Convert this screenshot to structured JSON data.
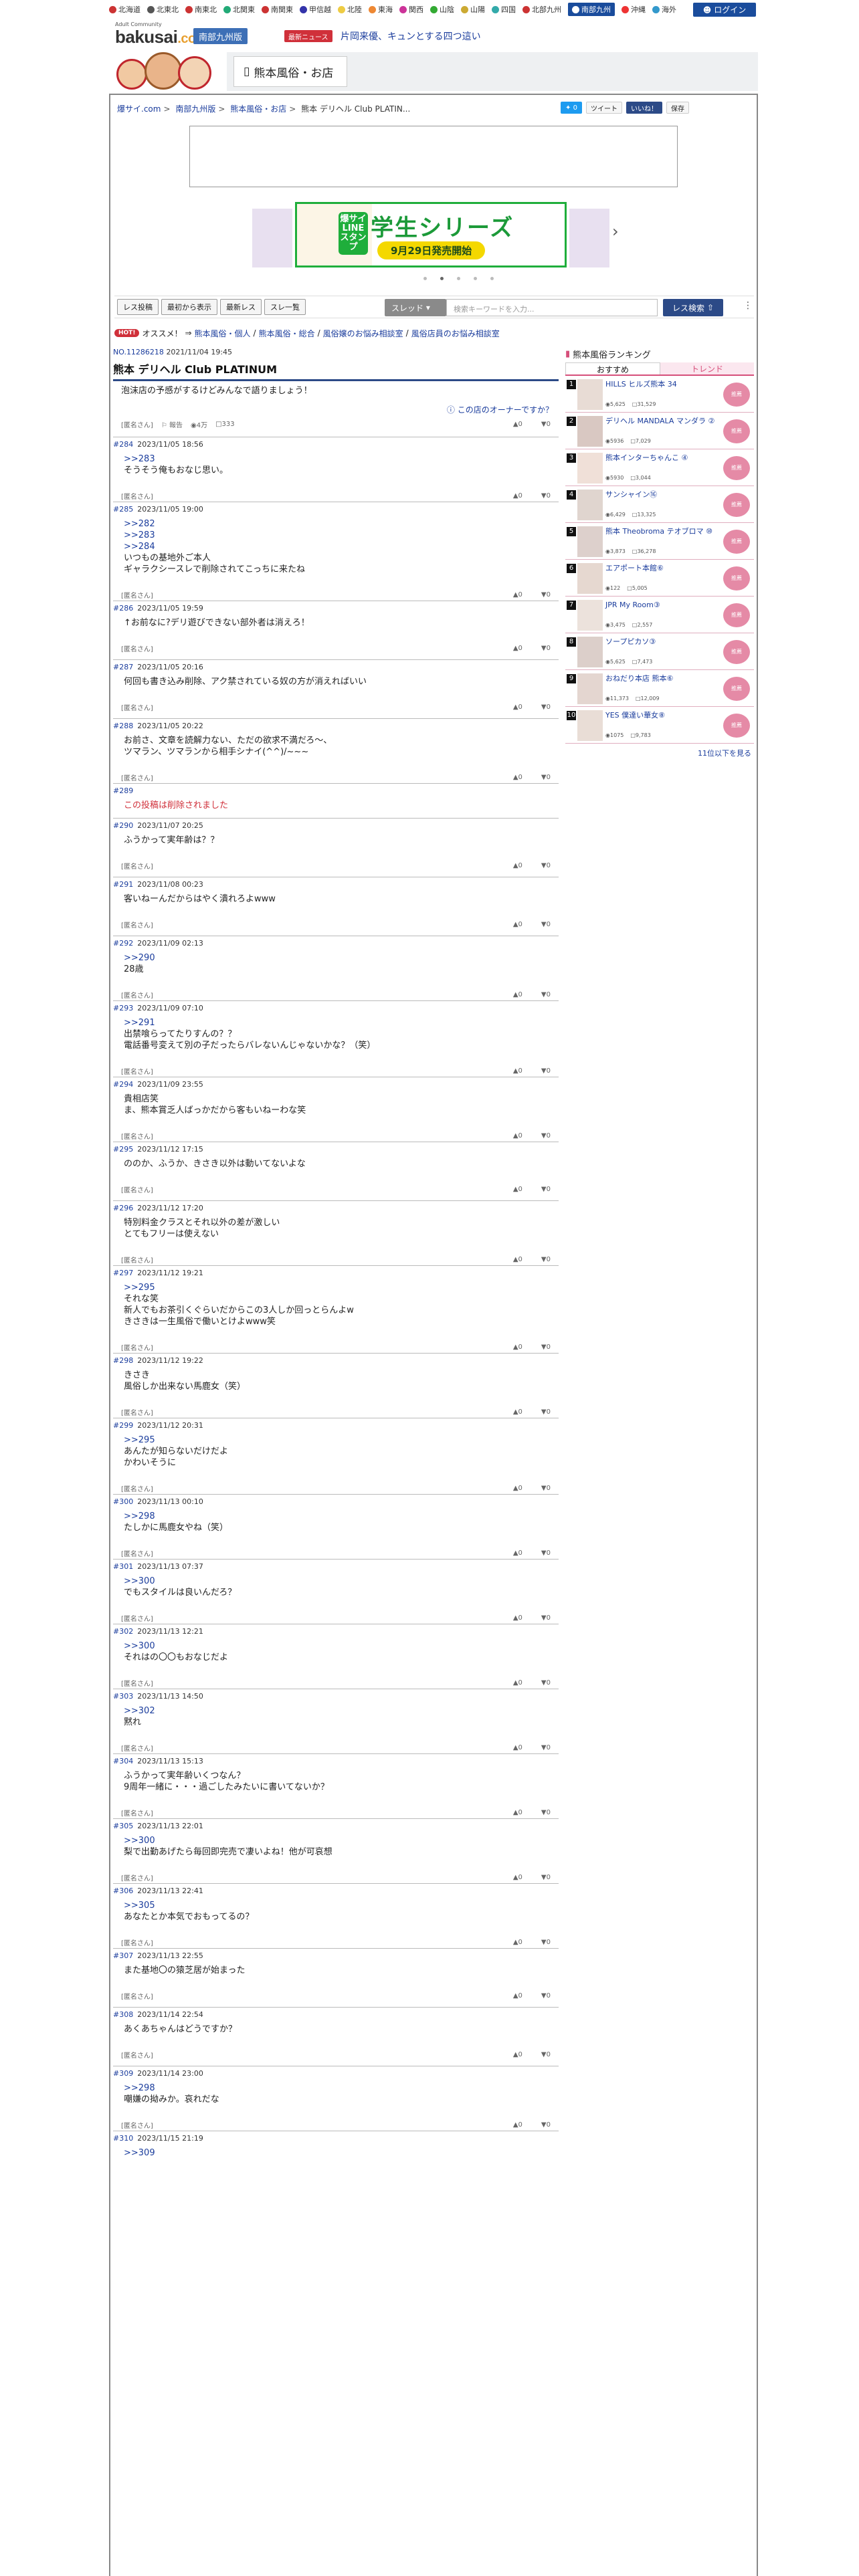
{
  "regions": [
    {
      "label": "北海道",
      "color": "#c33"
    },
    {
      "label": "北東北",
      "color": "#555"
    },
    {
      "label": "南東北",
      "color": "#c33"
    },
    {
      "label": "北関東",
      "color": "#2a7"
    },
    {
      "label": "南関東",
      "color": "#c33"
    },
    {
      "label": "甲信越",
      "color": "#33a"
    },
    {
      "label": "北陸",
      "color": "#ec4"
    },
    {
      "label": "東海",
      "color": "#e83"
    },
    {
      "label": "関西",
      "color": "#c39"
    },
    {
      "label": "山陰",
      "color": "#3a3"
    },
    {
      "label": "山陽",
      "color": "#ca3"
    },
    {
      "label": "四国",
      "color": "#3aa"
    },
    {
      "label": "北部九州",
      "color": "#c33"
    },
    {
      "label": "南部九州",
      "color": "#1a4c9c"
    },
    {
      "label": "沖縄",
      "color": "#e33"
    },
    {
      "label": "海外",
      "color": "#39c"
    }
  ],
  "active_region": "南部九州",
  "login_label": "ログイン",
  "header": {
    "logo_small": "Adult Community",
    "logo_main": "bakusai",
    "logo_tld": ".com",
    "region_tag": "南部九州版",
    "news_tag": "最新ニュース",
    "news_text": "片岡来優、キュンとする四つ這い",
    "category": "熊本風俗・お店"
  },
  "breadcrumbs": [
    "爆サイ.com",
    "南部九州版",
    "熊本風俗・お店",
    "熊本 デリヘル Club PLATIN..."
  ],
  "share": {
    "tweet_count": "0",
    "tweet": "ツイート",
    "good": "いいね！",
    "save": "保存"
  },
  "banner": {
    "title": "学生シリーズ",
    "sub": "9月29日発売開始",
    "label": "爆サイLINEスタンプ"
  },
  "toolbar": {
    "buttons": [
      "レス投稿",
      "最初から表示",
      "最新レス",
      "スレ一覧"
    ],
    "select_label": "スレッド",
    "keyword_placeholder": "検索キーワードを入力...",
    "search_btn": "レス検索"
  },
  "hot": {
    "badge": "HOT!",
    "label": "オススメ！",
    "links": [
      "熊本風俗・個人",
      "熊本風俗・総合",
      "風俗嬢のお悩み相談室",
      "風俗店員のお悩み相談室"
    ]
  },
  "thread": {
    "id_label": "NO.",
    "id": "11286218",
    "date": "2021/11/04 19:45",
    "title": "熊本 デリヘル Club PLATINUM",
    "op_body": "泡沫店の予感がするけどみんなで語りましょう！",
    "owner_link": "この店のオーナーですか？",
    "op_author": "[匿名さん]",
    "op_report": "報告",
    "op_views": "4万",
    "op_replies": "333",
    "vote_good": "0",
    "vote_bad": "0"
  },
  "posts": [
    {
      "no": "#284",
      "date": "2023/11/05 18:56",
      "anchors": [
        ">>283"
      ],
      "text": "そうそう俺もおなじ思い。",
      "author": "[匿名さん]",
      "good": "0",
      "bad": "0"
    },
    {
      "no": "#285",
      "date": "2023/11/05 19:00",
      "anchors": [
        ">>282",
        ">>283",
        ">>284"
      ],
      "text": "いつもの基地外ご本人\nギャラクシースレで削除されてこっちに来たね",
      "author": "[匿名さん]",
      "good": "0",
      "bad": "0"
    },
    {
      "no": "#286",
      "date": "2023/11/05 19:59",
      "anchors": [],
      "text": "↑お前なに?デリ遊びできない部外者は消えろ！",
      "author": "[匿名さん]",
      "good": "0",
      "bad": "0"
    },
    {
      "no": "#287",
      "date": "2023/11/05 20:16",
      "anchors": [],
      "text": "何回も書き込み削除、アク禁されている奴の方が消えればいい",
      "author": "[匿名さん]",
      "good": "0",
      "bad": "0"
    },
    {
      "no": "#288",
      "date": "2023/11/05 20:22",
      "anchors": [],
      "text": "お前さ、文章を読解力ない、ただの欲求不満だろ〜、\nツマラン、ツマランから相手シナイ(^^)/~~~",
      "author": "[匿名さん]",
      "good": "0",
      "bad": "0"
    },
    {
      "no": "#289",
      "date": "",
      "anchors": [],
      "text": "この投稿は削除されました",
      "deleted": true,
      "author": "",
      "good": "",
      "bad": ""
    },
    {
      "no": "#290",
      "date": "2023/11/07 20:25",
      "anchors": [],
      "text": "ふうかって実年齢は？？",
      "author": "[匿名さん]",
      "good": "0",
      "bad": "0"
    },
    {
      "no": "#291",
      "date": "2023/11/08 00:23",
      "anchors": [],
      "text": "客いねーんだからはやく潰れろよwww",
      "author": "[匿名さん]",
      "good": "0",
      "bad": "0"
    },
    {
      "no": "#292",
      "date": "2023/11/09 02:13",
      "anchors": [
        ">>290"
      ],
      "text": "28歳",
      "author": "[匿名さん]",
      "good": "0",
      "bad": "0"
    },
    {
      "no": "#293",
      "date": "2023/11/09 07:10",
      "anchors": [
        ">>291"
      ],
      "text": "出禁喰らってたりすんの？？\n電話番号変えて別の子だったらバレないんじゃないかな？（笑）",
      "author": "[匿名さん]",
      "good": "0",
      "bad": "0"
    },
    {
      "no": "#294",
      "date": "2023/11/09 23:55",
      "anchors": [],
      "text": "貴相店笑\nま、熊本賞乏人ばっかだから客もいねーわな笑",
      "author": "[匿名さん]",
      "good": "0",
      "bad": "0"
    },
    {
      "no": "#295",
      "date": "2023/11/12 17:15",
      "anchors": [],
      "text": "ののか、ふうか、きさき以外は動いてないよな",
      "author": "[匿名さん]",
      "good": "0",
      "bad": "0"
    },
    {
      "no": "#296",
      "date": "2023/11/12 17:20",
      "anchors": [],
      "text": "特別料金クラスとそれ以外の差が激しい\nとてもフリーは使えない",
      "author": "[匿名さん]",
      "good": "0",
      "bad": "0"
    },
    {
      "no": "#297",
      "date": "2023/11/12 19:21",
      "anchors": [
        ">>295"
      ],
      "text": "それな笑\n新人でもお茶引くぐらいだからこの3人しか回っとらんよw\nきさきは一生風俗で働いとけよwww笑",
      "author": "[匿名さん]",
      "good": "0",
      "bad": "0"
    },
    {
      "no": "#298",
      "date": "2023/11/12 19:22",
      "anchors": [],
      "text": "きさき\n風俗しか出来ない馬鹿女（笑）",
      "author": "[匿名さん]",
      "good": "0",
      "bad": "0"
    },
    {
      "no": "#299",
      "date": "2023/11/12 20:31",
      "anchors": [
        ">>295"
      ],
      "text": "あんたが知らないだけだよ\nかわいそうに",
      "author": "[匿名さん]",
      "good": "0",
      "bad": "0"
    },
    {
      "no": "#300",
      "date": "2023/11/13 00:10",
      "anchors": [
        ">>298"
      ],
      "text": "たしかに馬鹿女やね（笑）",
      "author": "[匿名さん]",
      "good": "0",
      "bad": "0"
    },
    {
      "no": "#301",
      "date": "2023/11/13 07:37",
      "anchors": [
        ">>300"
      ],
      "text": "でもスタイルは良いんだろ？",
      "author": "[匿名さん]",
      "good": "0",
      "bad": "0"
    },
    {
      "no": "#302",
      "date": "2023/11/13 12:21",
      "anchors": [
        ">>300"
      ],
      "text": "それはの〇〇もおなじだよ",
      "author": "[匿名さん]",
      "good": "0",
      "bad": "0"
    },
    {
      "no": "#303",
      "date": "2023/11/13 14:50",
      "anchors": [
        ">>302"
      ],
      "text": "黙れ",
      "author": "[匿名さん]",
      "good": "0",
      "bad": "0"
    },
    {
      "no": "#304",
      "date": "2023/11/13 15:13",
      "anchors": [],
      "text": "ふうかって実年齢いくつなん？\n9周年一緒に・・・過ごしたみたいに書いてないか？",
      "author": "[匿名さん]",
      "good": "0",
      "bad": "0"
    },
    {
      "no": "#305",
      "date": "2023/11/13 22:01",
      "anchors": [
        ">>300"
      ],
      "text": "梨で出勤あげたら毎回即完売で凄いよね！他が可哀想",
      "author": "[匿名さん]",
      "good": "0",
      "bad": "0"
    },
    {
      "no": "#306",
      "date": "2023/11/13 22:41",
      "anchors": [
        ">>305"
      ],
      "text": "あなたとか本気でおもってるの？",
      "author": "[匿名さん]",
      "good": "0",
      "bad": "0"
    },
    {
      "no": "#307",
      "date": "2023/11/13 22:55",
      "anchors": [],
      "text": "また基地〇の猿芝居が始まった",
      "author": "[匿名さん]",
      "good": "0",
      "bad": "0"
    },
    {
      "no": "#308",
      "date": "2023/11/14 22:54",
      "anchors": [],
      "text": "あくあちゃんはどうですか？",
      "author": "[匿名さん]",
      "good": "0",
      "bad": "0"
    },
    {
      "no": "#309",
      "date": "2023/11/14 23:00",
      "anchors": [
        ">>298"
      ],
      "text": "嘲嫌の拗みか。哀れだな",
      "author": "[匿名さん]",
      "good": "0",
      "bad": "0"
    },
    {
      "no": "#310",
      "date": "2023/11/15 21:19",
      "anchors": [
        ">>309"
      ],
      "text": "",
      "author": "",
      "good": "",
      "bad": ""
    }
  ],
  "ranking": {
    "title": "熊本風俗ランキング",
    "tab_recommend": "おすすめ",
    "tab_trend": "トレンド",
    "items": [
      {
        "rank": "1",
        "name": "HILLS ヒルズ熊本 34",
        "views": "5,625",
        "res": "31,529"
      },
      {
        "rank": "2",
        "name": "デリヘル MANDALA マンダラ ②",
        "views": "5936",
        "res": "7,029"
      },
      {
        "rank": "3",
        "name": "熊本インターちゃんこ ④",
        "views": "5930",
        "res": "3,044"
      },
      {
        "rank": "4",
        "name": "サンシャイン⑯",
        "views": "6,429",
        "res": "13,325"
      },
      {
        "rank": "5",
        "name": "熊本 Theobroma テオブロマ ⑩",
        "views": "3,873",
        "res": "36,278"
      },
      {
        "rank": "6",
        "name": "エアポート本館⑥",
        "views": "122",
        "res": "5,005"
      },
      {
        "rank": "7",
        "name": "JPR My Room③",
        "views": "3,475",
        "res": "2,557"
      },
      {
        "rank": "8",
        "name": "ソープピカソ③",
        "views": "5,625",
        "res": "7,473"
      },
      {
        "rank": "9",
        "name": "おねだり本店 熊本⑥",
        "views": "11,373",
        "res": "12,009"
      },
      {
        "rank": "10",
        "name": "YES 僕達い華女⑧",
        "views": "1075",
        "res": "9,783"
      }
    ],
    "badge": "推薦",
    "more": "11位以下を見る"
  }
}
